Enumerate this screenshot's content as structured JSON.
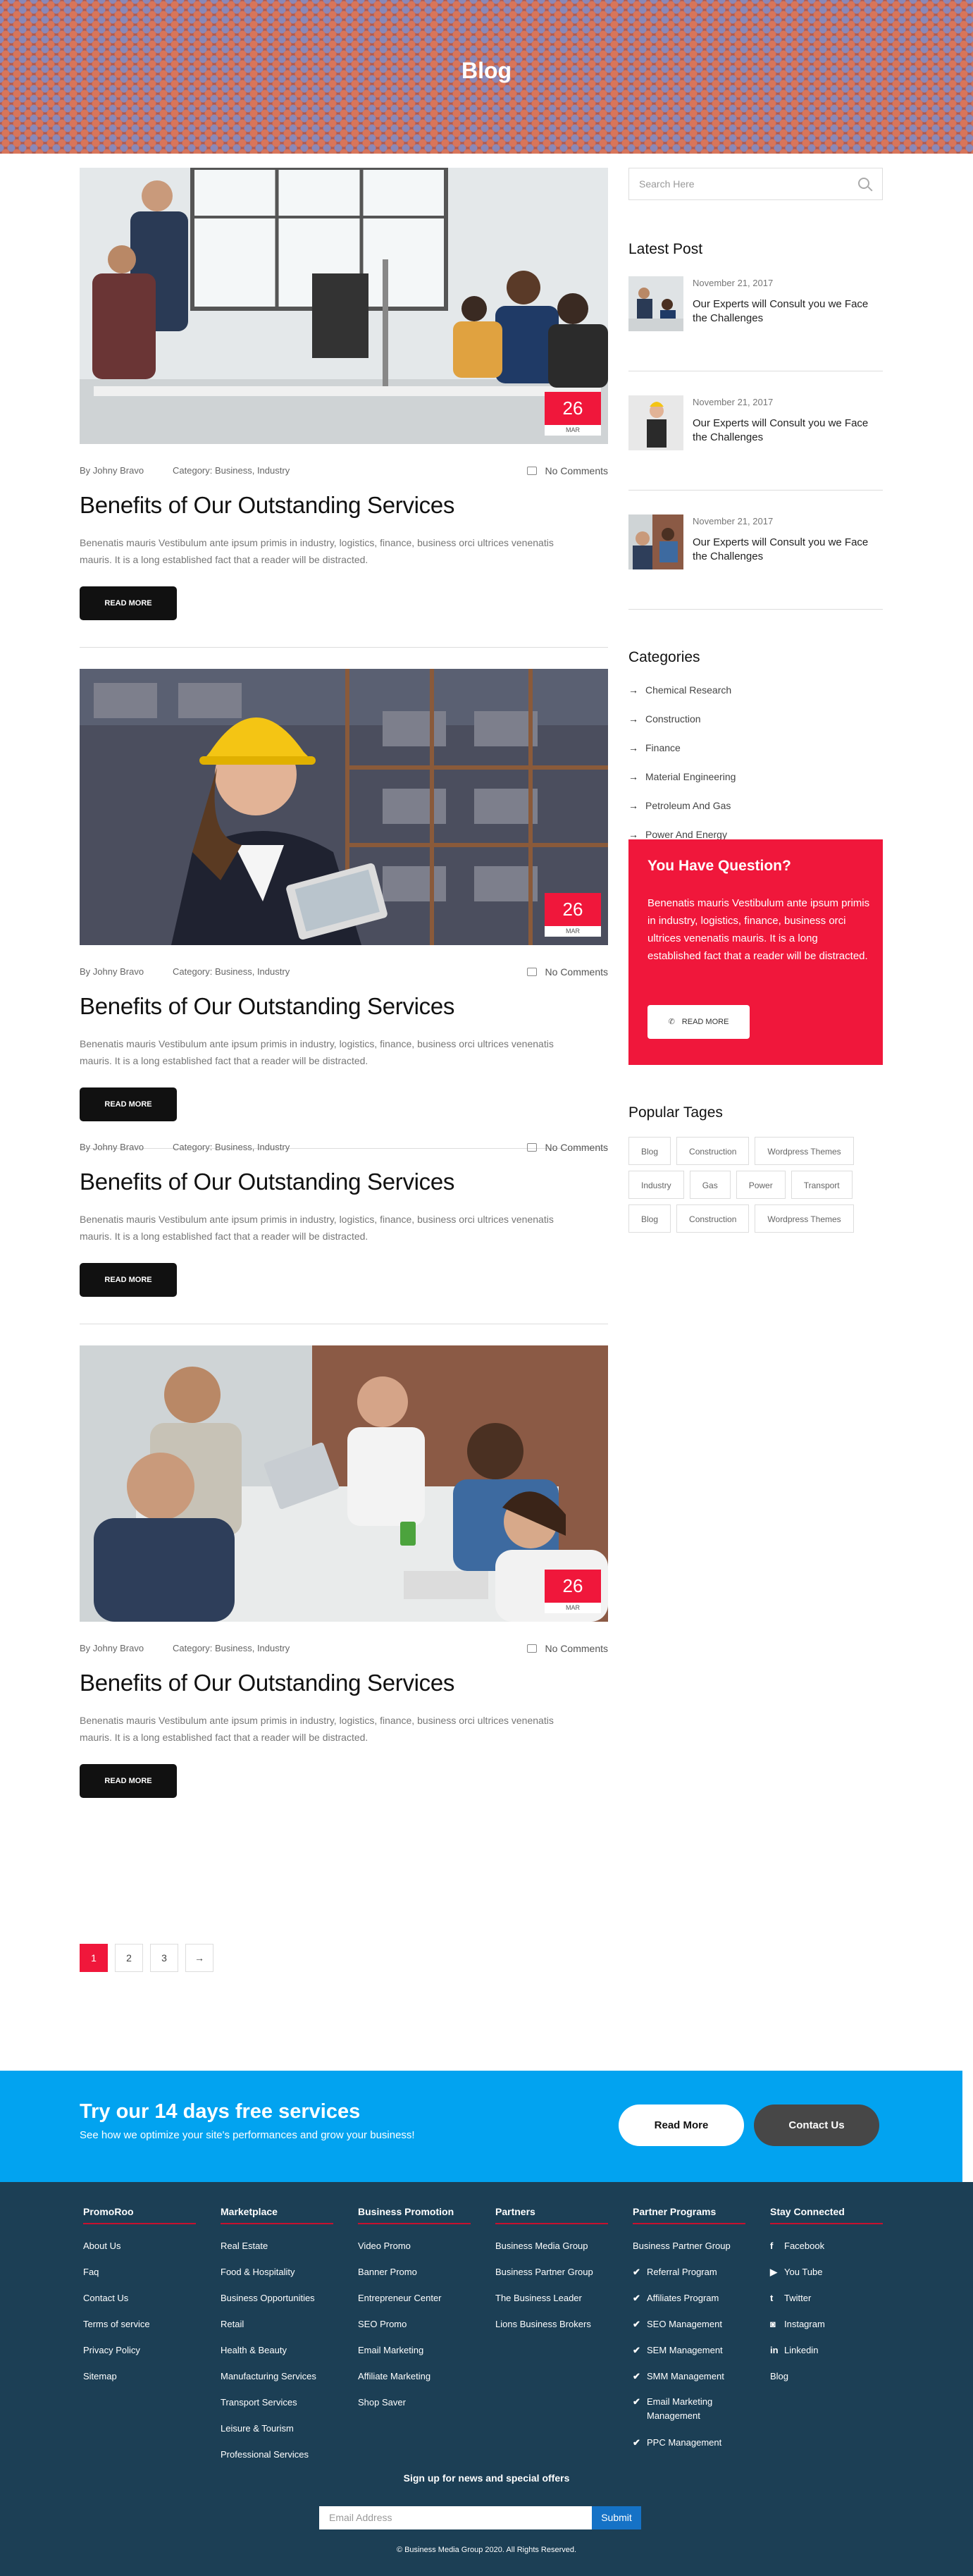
{
  "hero": {
    "title": "Blog"
  },
  "posts": [
    {
      "day": "26",
      "month": "MAR",
      "author": "By Johny Bravo",
      "category": "Category: Business, Industry",
      "comments": "No Comments",
      "title": "Benefits of Our Outstanding Services",
      "excerpt": "Benenatis mauris Vestibulum ante ipsum primis in industry, logistics, finance, business orci ultrices venenatis mauris. It is a long established fact that a reader will be distracted.",
      "button": "READ MORE"
    },
    {
      "day": "26",
      "month": "MAR",
      "author": "By Johny Bravo",
      "category": "Category: Business, Industry",
      "comments": "No Comments",
      "title": "Benefits of Our Outstanding Services",
      "excerpt": "Benenatis mauris Vestibulum ante ipsum primis in industry, logistics, finance, business orci ultrices venenatis mauris. It is a long established fact that a reader will be distracted.",
      "button": "READ MORE"
    },
    {
      "author": "By Johny Bravo",
      "category": "Category: Business, Industry",
      "comments": "No Comments",
      "title": "Benefits of Our Outstanding Services",
      "excerpt": "Benenatis mauris Vestibulum ante ipsum primis in industry, logistics, finance, business orci ultrices venenatis mauris. It is a long established fact that a reader will be distracted.",
      "button": "READ MORE"
    },
    {
      "day": "26",
      "month": "MAR",
      "author": "By Johny Bravo",
      "category": "Category: Business, Industry",
      "comments": "No Comments",
      "title": "Benefits of Our Outstanding Services",
      "excerpt": "Benenatis mauris Vestibulum ante ipsum primis in industry, logistics, finance, business orci ultrices venenatis mauris. It is a long established fact that a reader will be distracted.",
      "button": "READ MORE"
    }
  ],
  "pagination": [
    "1",
    "2",
    "3",
    "→"
  ],
  "sidebar": {
    "search_placeholder": "Search Here",
    "latest_heading": "Latest Post",
    "latest": [
      {
        "date": "November 21, 2017",
        "title": "Our Experts will Consult you we Face the Challenges"
      },
      {
        "date": "November 21, 2017",
        "title": "Our Experts will Consult you we Face the Challenges"
      },
      {
        "date": "November 21, 2017",
        "title": "Our Experts will Consult you we Face the Challenges"
      }
    ],
    "categories_heading": "Categories",
    "categories": [
      "Chemical Research",
      "Construction",
      "Finance",
      "Material Engineering",
      "Petroleum And Gas",
      "Power And Energy"
    ],
    "question": {
      "title": "You Have Question?",
      "text": "Benenatis mauris Vestibulum ante ipsum primis in industry, logistics, finance, business orci ultrices venenatis mauris. It is a long established fact that a reader will be distracted.",
      "button": "READ MORE"
    },
    "tags_heading": "Popular Tages",
    "tags": [
      "Blog",
      "Construction",
      "Wordpress Themes",
      "Industry",
      "Gas",
      "Power",
      "Transport",
      "Blog",
      "Construction",
      "Wordpress Themes"
    ]
  },
  "cta": {
    "title": "Try our 14 days free services",
    "subtitle": "See how we optimize your site's performances and grow your business!",
    "read_more": "Read More",
    "contact": "Contact Us"
  },
  "footer": {
    "columns": [
      {
        "title": "PromoRoo",
        "items": [
          "About Us",
          "Faq",
          "Contact Us",
          "Terms of service",
          "Privacy Policy",
          "Sitemap"
        ]
      },
      {
        "title": "Marketplace",
        "items": [
          "Real Estate",
          "Food & Hospitality",
          "Business Opportunities",
          "Retail",
          "Health & Beauty",
          "Manufacturing Services",
          "Transport Services",
          "Leisure & Tourism",
          "Professional Services"
        ]
      },
      {
        "title": "Business Promotion",
        "items": [
          "Video Promo",
          "Banner Promo",
          "Entrepreneur Center",
          "SEO Promo",
          "Email Marketing",
          "Affiliate Marketing",
          "Shop Saver"
        ]
      },
      {
        "title": "Partners",
        "items": [
          "Business Media Group",
          "Business Partner Group",
          "The Business Leader",
          "Lions Business Brokers"
        ]
      },
      {
        "title": "Partner Programs",
        "items": [
          "Business Partner Group",
          "Referral Program",
          "Affiliates Program",
          "SEO Management",
          "SEM Management",
          "SMM Management",
          "Email Marketing Management",
          "PPC Management"
        ]
      },
      {
        "title": "Stay Connected",
        "items": [
          "Facebook",
          "You Tube",
          "Twitter",
          "Instagram",
          "Linkedin",
          "Blog"
        ]
      }
    ],
    "signup": "Sign up for news and special offers",
    "email_placeholder": "Email Address",
    "submit": "Submit",
    "copyright": "© Business Media Group 2020. All Rights Reserved."
  },
  "colors": {
    "accent": "#f0173b",
    "cta": "#02a3f0",
    "footer": "#1c3f55"
  }
}
